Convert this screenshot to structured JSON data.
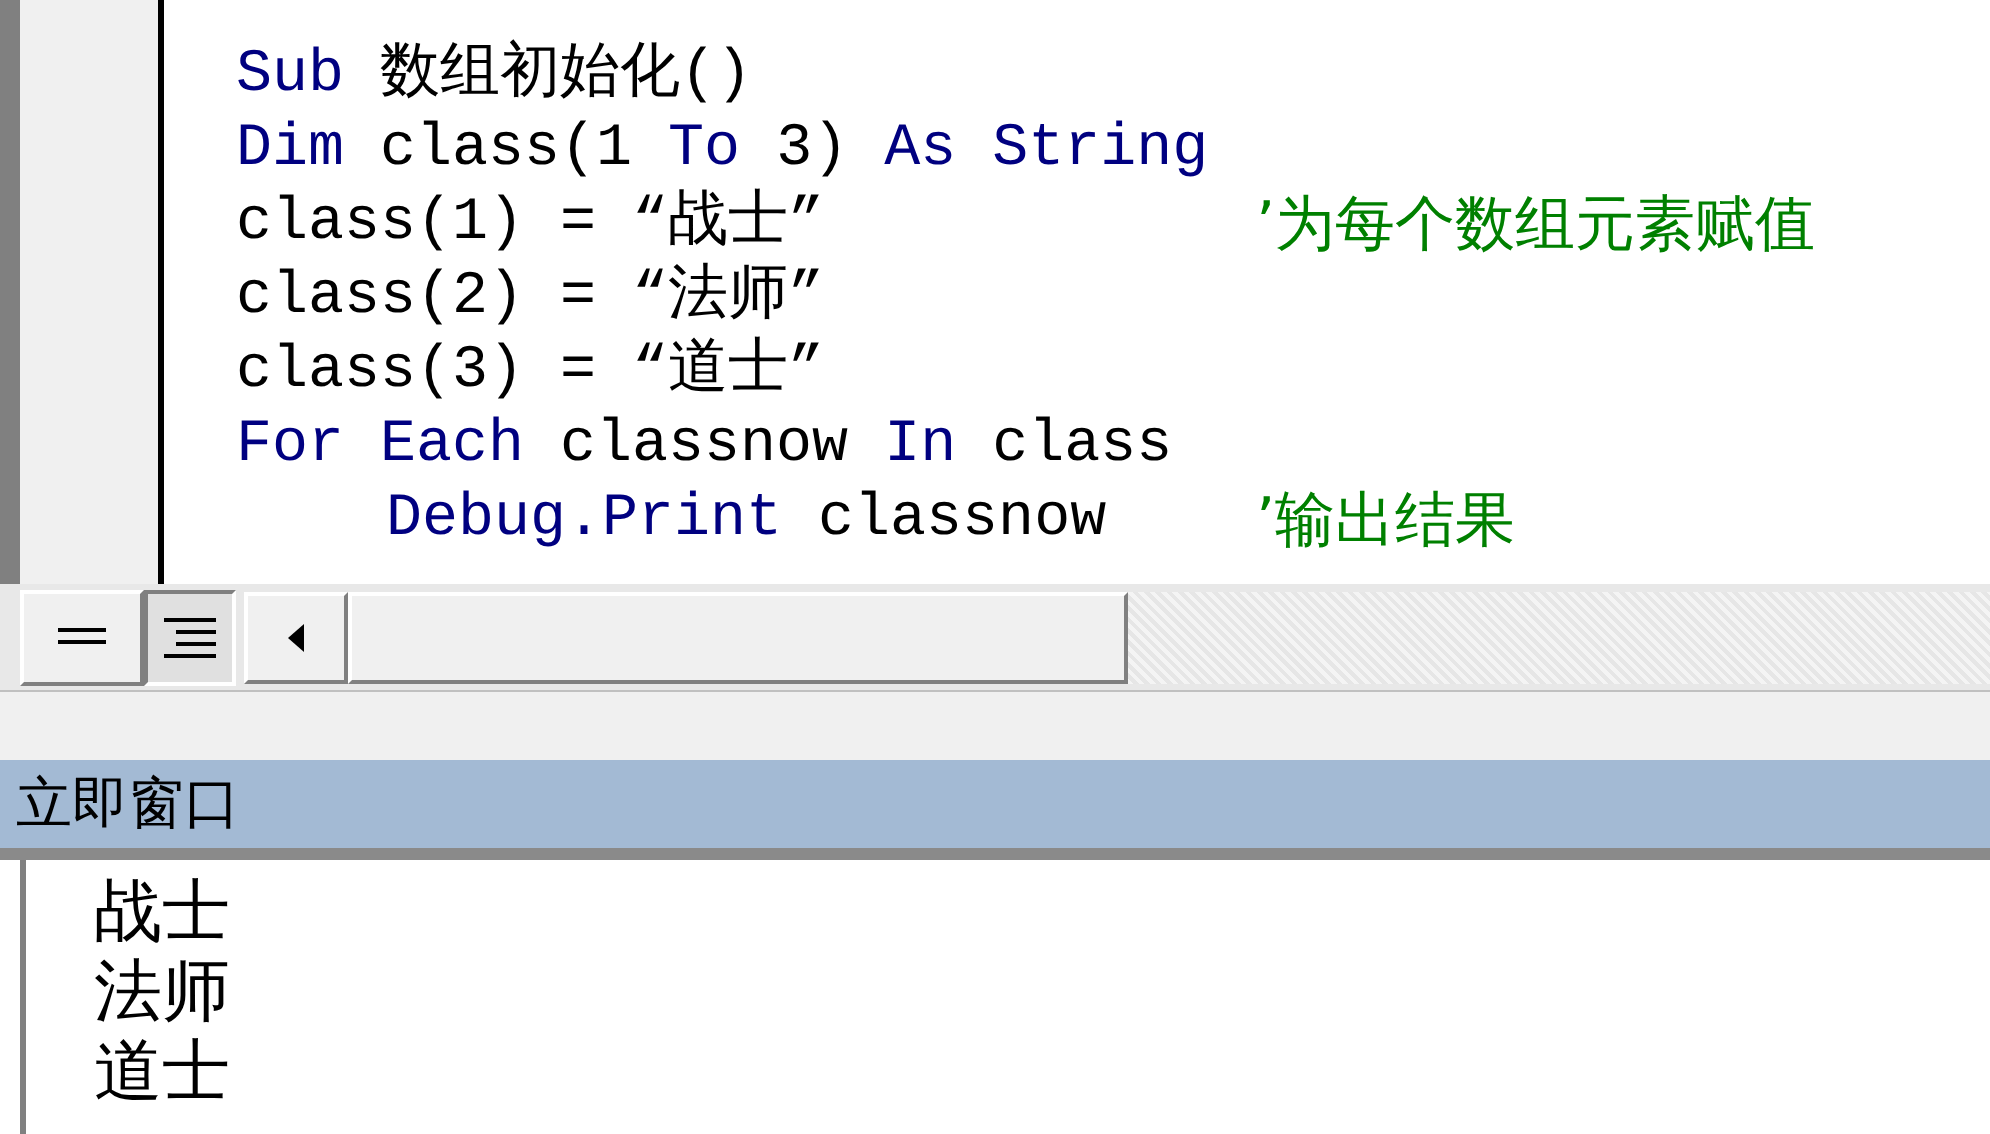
{
  "code_lines": [
    {
      "indented": false,
      "tokens": [
        {
          "kind": "keyword",
          "text": "Sub"
        },
        {
          "kind": "plain",
          "text": "数组初始化()"
        }
      ]
    },
    {
      "indented": false,
      "tokens": [
        {
          "kind": "keyword",
          "text": "Dim"
        },
        {
          "kind": "plain",
          "text": "class(1"
        },
        {
          "kind": "keyword",
          "text": "To"
        },
        {
          "kind": "plain",
          "text": "3)"
        },
        {
          "kind": "keyword",
          "text": "As"
        },
        {
          "kind": "keyword",
          "text": "String"
        }
      ]
    },
    {
      "indented": false,
      "tokens": [
        {
          "kind": "plain",
          "text": "class(1) = “战士”"
        },
        {
          "kind": "comment",
          "text": "’为每个数组元素赋值"
        }
      ]
    },
    {
      "indented": false,
      "tokens": [
        {
          "kind": "plain",
          "text": "class(2) = “法师”"
        }
      ]
    },
    {
      "indented": false,
      "tokens": [
        {
          "kind": "plain",
          "text": "class(3) = “道士”"
        }
      ]
    },
    {
      "indented": false,
      "tokens": [
        {
          "kind": "keyword",
          "text": "For"
        },
        {
          "kind": "keyword",
          "text": "Each"
        },
        {
          "kind": "plain",
          "text": "classnow"
        },
        {
          "kind": "keyword",
          "text": "In"
        },
        {
          "kind": "plain",
          "text": "class"
        }
      ]
    },
    {
      "indented": true,
      "tokens": [
        {
          "kind": "keyword",
          "text": "Debug.Print"
        },
        {
          "kind": "plain",
          "text": "classnow"
        },
        {
          "kind": "comment",
          "text": "’输出结果"
        }
      ]
    }
  ],
  "immediate_window": {
    "title": "立即窗口",
    "output": [
      "战士",
      "法师",
      "道士"
    ]
  }
}
